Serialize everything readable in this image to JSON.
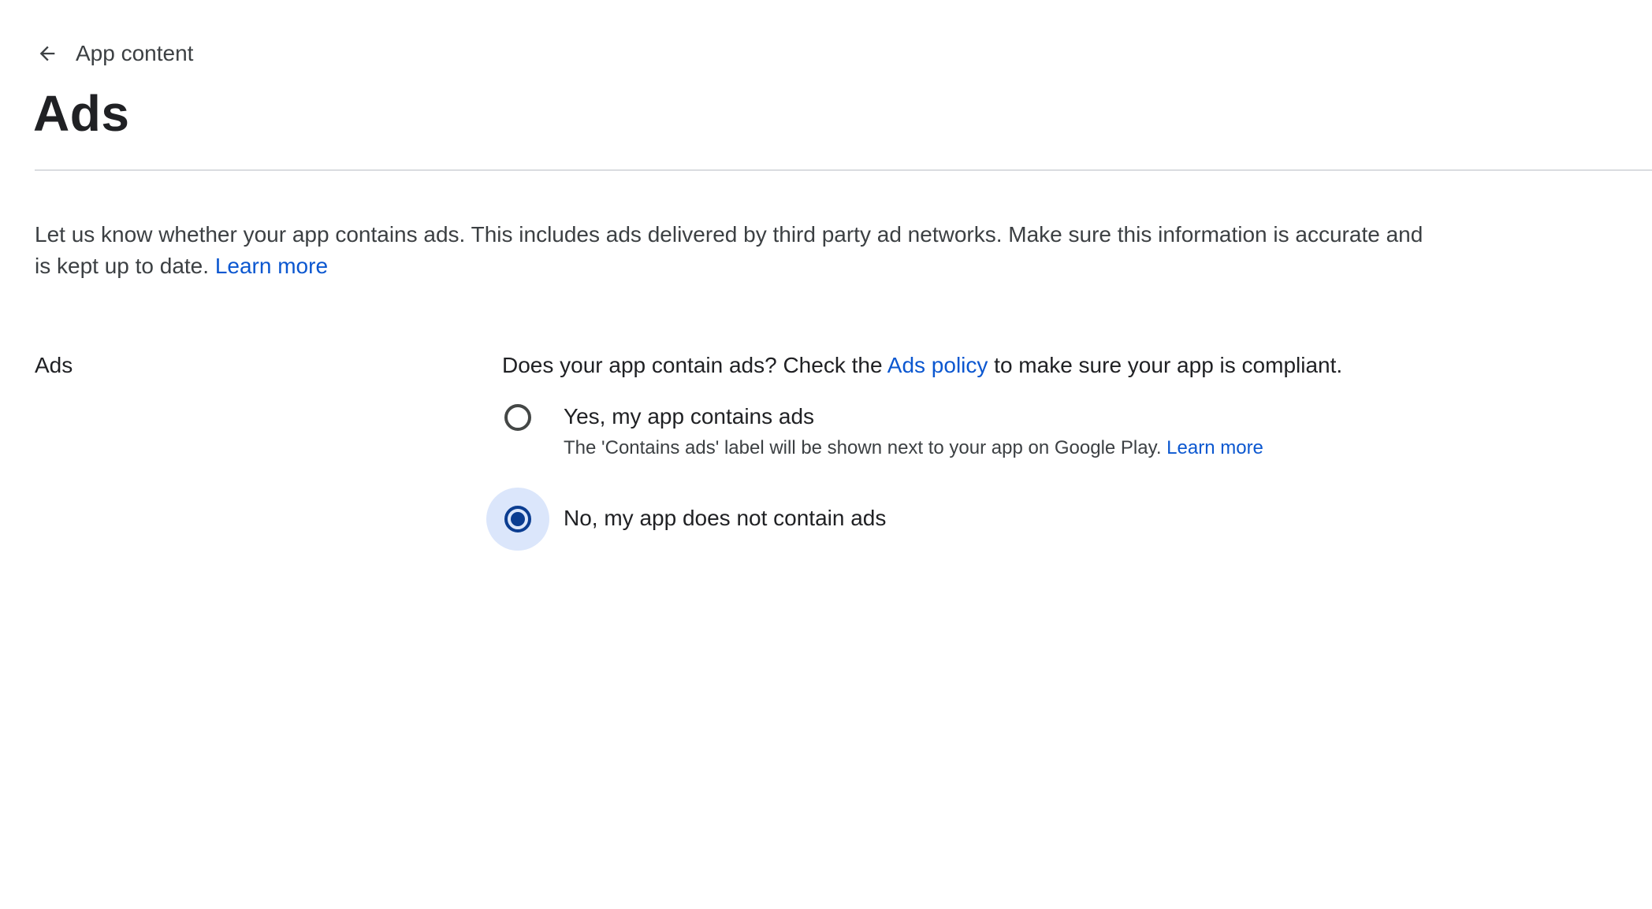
{
  "header": {
    "back_label": "App content",
    "title": "Ads"
  },
  "intro": {
    "text": "Let us know whether your app contains ads. This includes ads delivered by third party ad networks. Make sure this information is accurate and is kept up to date.",
    "learn_more": "Learn more"
  },
  "section": {
    "label": "Ads",
    "question_prefix": "Does your app contain ads? Check the",
    "policy_link": "Ads policy",
    "question_suffix": "to make sure your app is compliant."
  },
  "options": [
    {
      "label": "Yes, my app contains ads",
      "description": "The 'Contains ads' label will be shown next to your app on Google Play.",
      "learn_more": "Learn more",
      "selected": false
    },
    {
      "label": "No, my app does not contain ads",
      "selected": true
    }
  ],
  "colors": {
    "link": "#0b57d0",
    "radio_selected": "#0b3d91",
    "radio_focus_halo": "#dbe6fb",
    "divider": "#dadce0"
  },
  "icons": {
    "back": "arrow-back-icon"
  }
}
